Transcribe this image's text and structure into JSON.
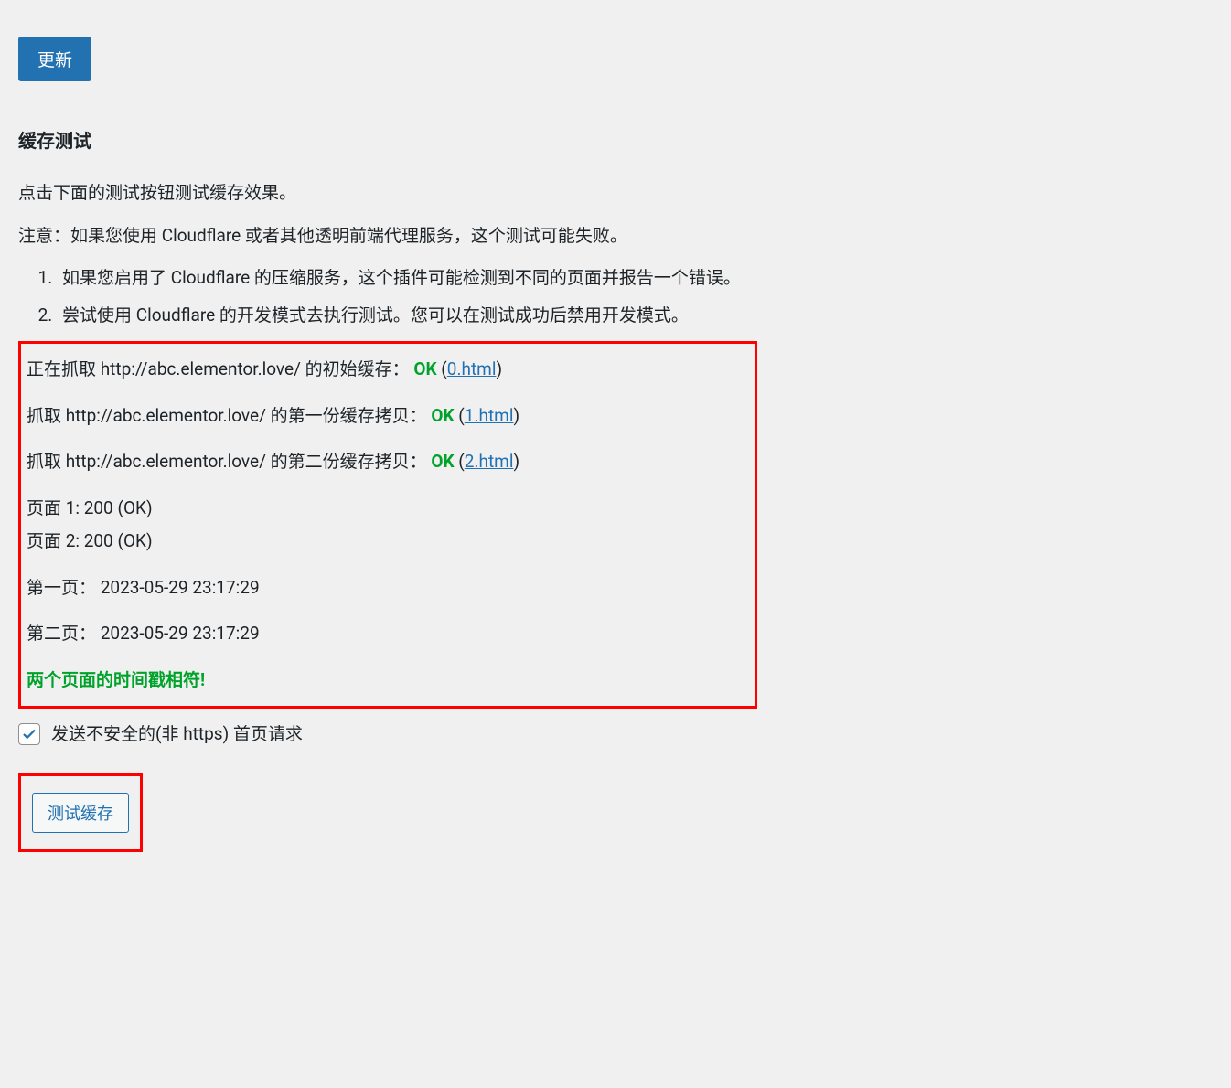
{
  "update_button": "更新",
  "section": {
    "title": "缓存测试",
    "intro": "点击下面的测试按钮测试缓存效果。",
    "notice": "注意：如果您使用 Cloudflare 或者其他透明前端代理服务，这个测试可能失败。",
    "tips": [
      "如果您启用了 Cloudflare 的压缩服务，这个插件可能检测到不同的页面并报告一个错误。",
      "尝试使用 Cloudflare 的开发模式去执行测试。您可以在测试成功后禁用开发模式。"
    ]
  },
  "results": {
    "line1_prefix": "正在抓取 http://abc.elementor.love/ 的初始缓存：",
    "line2_prefix": "抓取 http://abc.elementor.love/ 的第一份缓存拷贝：",
    "line3_prefix": "抓取 http://abc.elementor.love/ 的第二份缓存拷贝：",
    "ok": "OK",
    "link0": "0.html",
    "link1": "1.html",
    "link2": "2.html",
    "page1_status": "页面 1: 200 (OK)",
    "page2_status": "页面 2: 200 (OK)",
    "page1_time": "第一页： 2023-05-29 23:17:29",
    "page2_time": "第二页： 2023-05-29 23:17:29",
    "success": "两个页面的时间戳相符!"
  },
  "checkbox": {
    "checked": true,
    "label": "发送不安全的(非 https) 首页请求"
  },
  "test_button": "测试缓存"
}
